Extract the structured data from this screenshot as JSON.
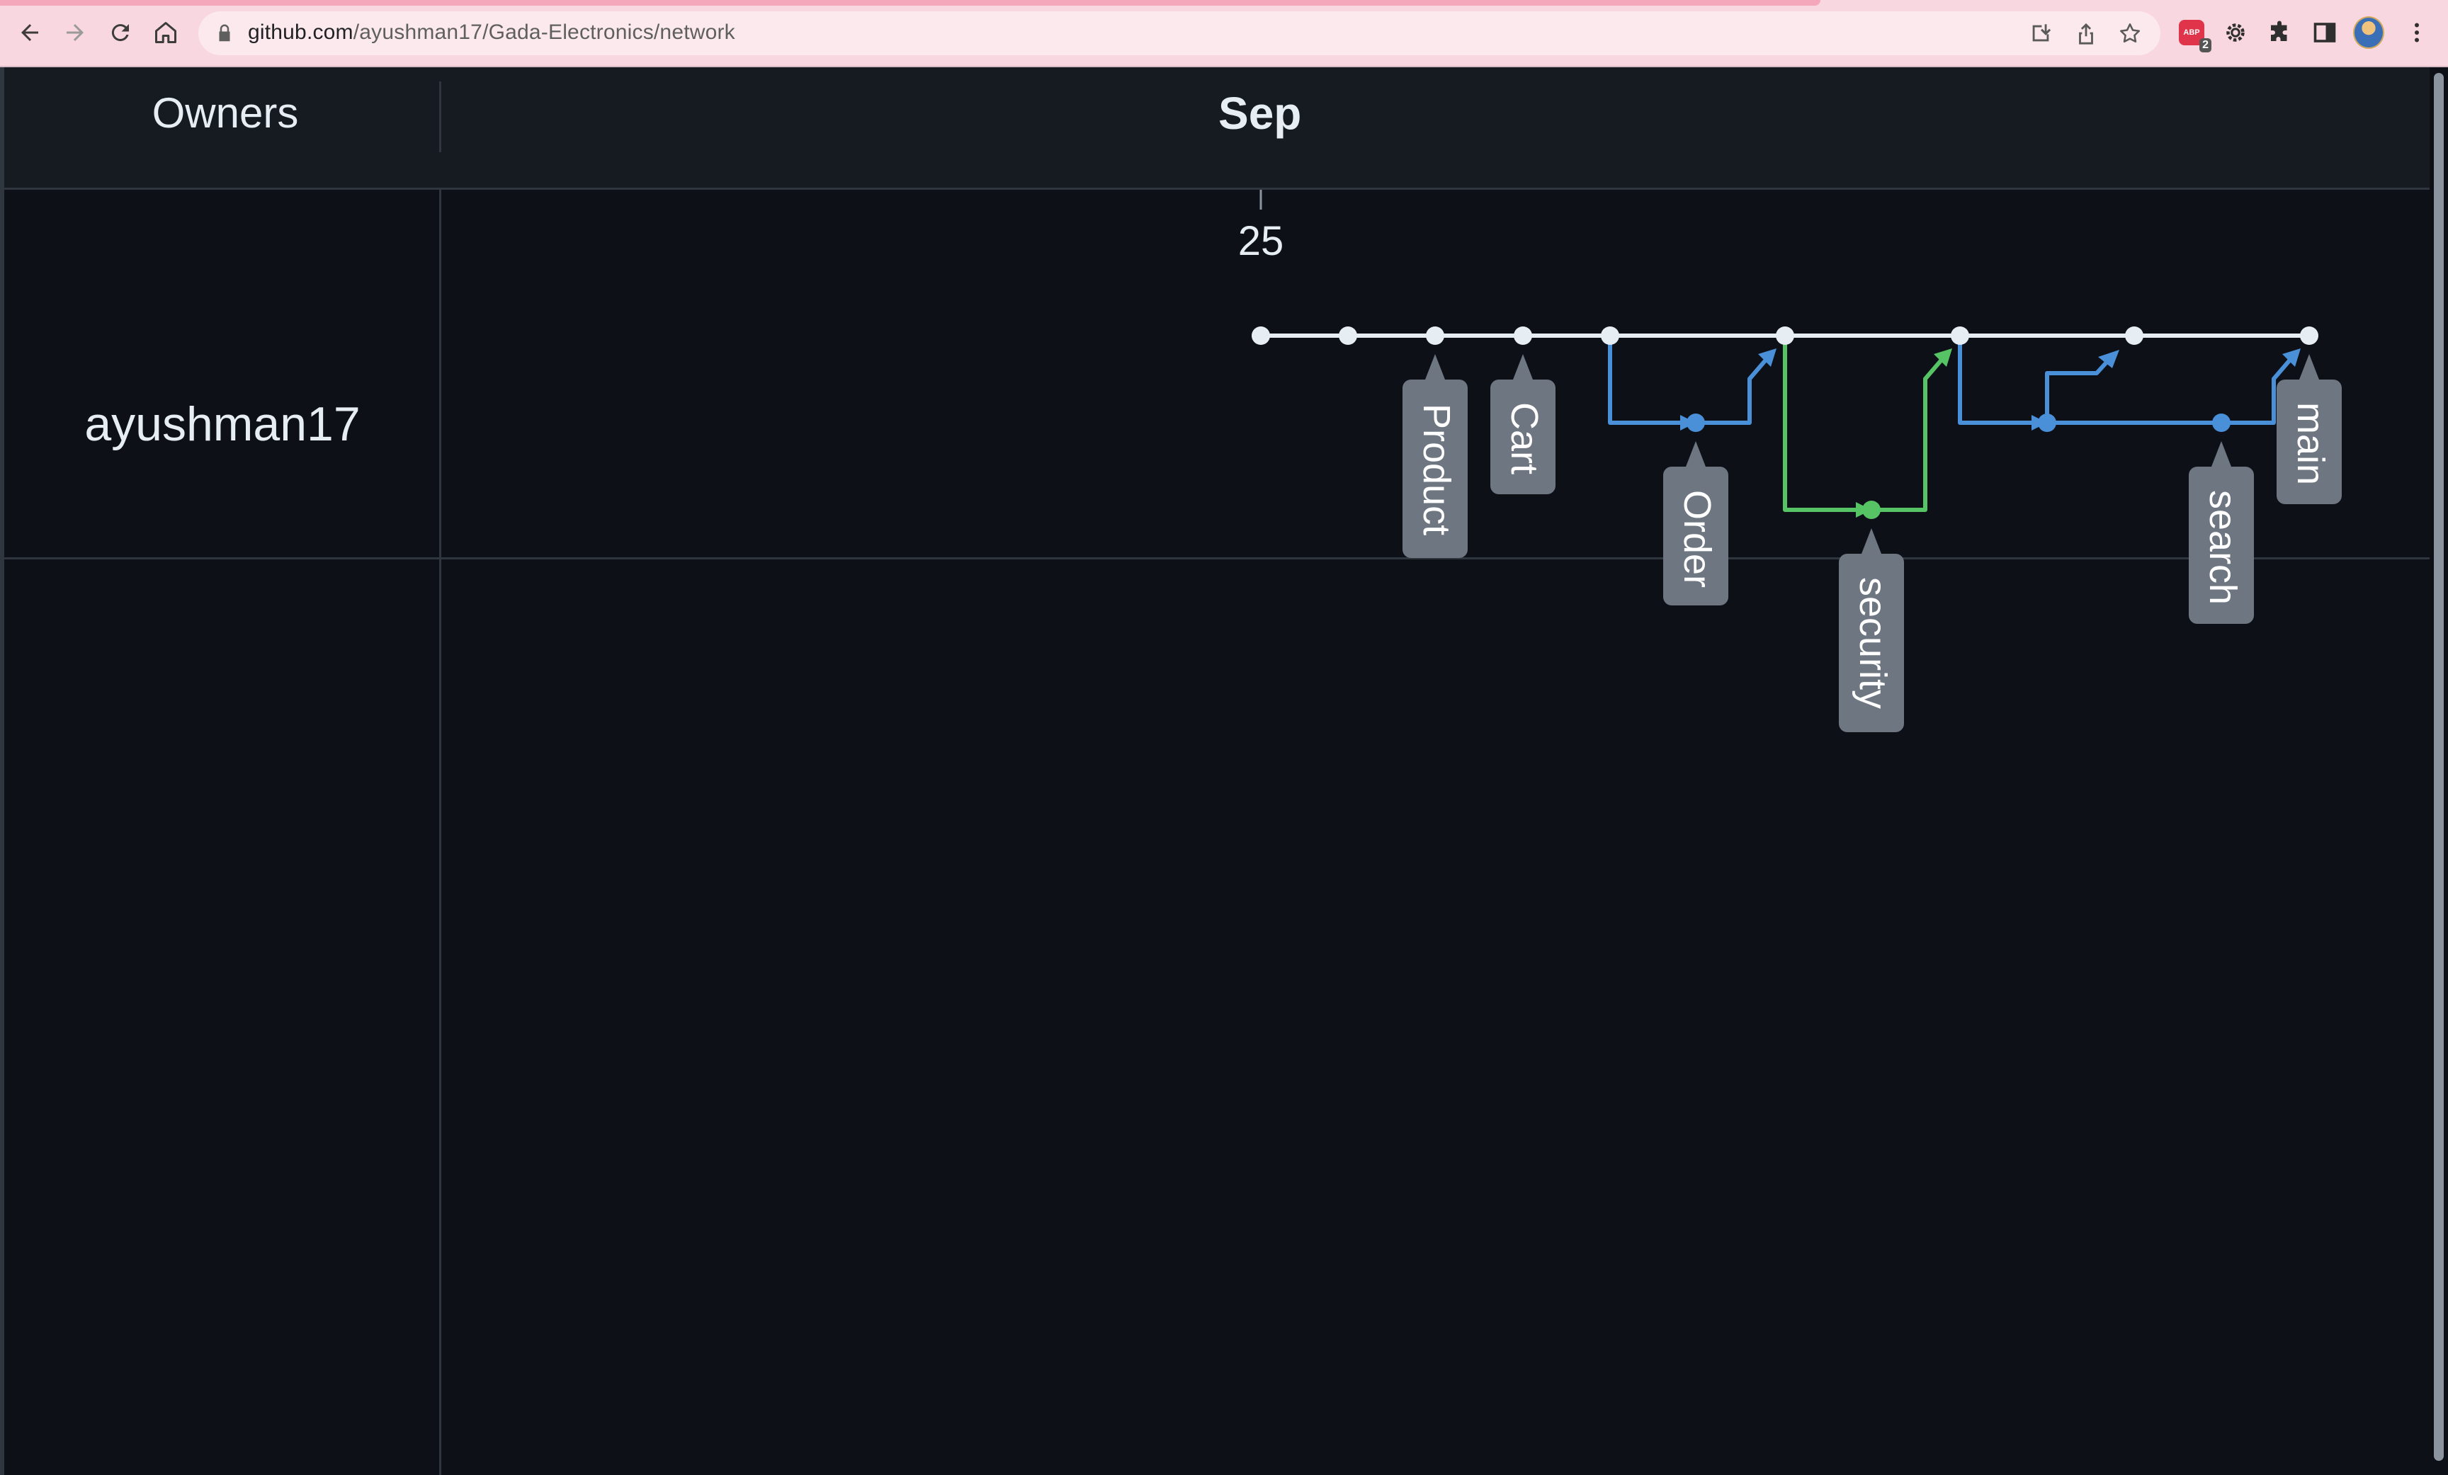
{
  "browser": {
    "url_host": "github.com",
    "url_path": "/ayushman17/Gada-Electronics/network",
    "extension_badge": "2",
    "abp_label": "ABP",
    "icons": [
      "back-icon",
      "forward-icon",
      "reload-icon",
      "home-icon",
      "lock-icon",
      "install-icon",
      "share-icon",
      "star-icon",
      "adblock-icon",
      "settings-extension-icon",
      "puzzle-icon",
      "sidepanel-icon",
      "avatar",
      "kebab-menu-icon"
    ]
  },
  "network": {
    "owners_label": "Owners",
    "month_label": "Sep",
    "day_label": "25",
    "owner": "ayushman17"
  },
  "colors": {
    "master": "#e6edf3",
    "blue": "#4a90d9",
    "green": "#56c465",
    "label_bg": "#6e7681",
    "bg": "#0d1117",
    "header_bg": "#161b22"
  },
  "branches": [
    "Product",
    "Cart",
    "Order",
    "security",
    "search",
    "main"
  ]
}
